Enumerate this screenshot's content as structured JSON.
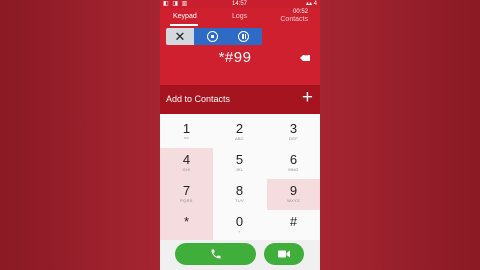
{
  "status": {
    "left": "◧ ◨ ▥",
    "time": "14:57",
    "right": "▴▴ 4"
  },
  "tabs": {
    "keypad": "Keypad",
    "logs": "Logs",
    "timer": "00:52",
    "contacts": "Contacts"
  },
  "dialed_number": "*#99",
  "add_to_contacts": "Add to Contacts",
  "add_plus": "+",
  "close_symbol": "✕",
  "keys": [
    {
      "digit": "1",
      "letters": "ᴼᴼ"
    },
    {
      "digit": "2",
      "letters": "ABC"
    },
    {
      "digit": "3",
      "letters": "DEF"
    },
    {
      "digit": "4",
      "letters": "GHI"
    },
    {
      "digit": "5",
      "letters": "JKL"
    },
    {
      "digit": "6",
      "letters": "MNO"
    },
    {
      "digit": "7",
      "letters": "PQRS"
    },
    {
      "digit": "8",
      "letters": "TUV"
    },
    {
      "digit": "9",
      "letters": "WXYZ"
    },
    {
      "digit": "*",
      "letters": ""
    },
    {
      "digit": "0",
      "letters": "+"
    },
    {
      "digit": "#",
      "letters": ""
    }
  ],
  "colors": {
    "accent": "#cf2030",
    "add_bar": "#a6141f",
    "call_green": "#3fae3a",
    "recorder_blue": "#2e6bc6"
  },
  "icons": {
    "call": "phone-icon",
    "video": "video-camera-icon",
    "backspace": "backspace-icon",
    "close": "close-icon",
    "stop": "stop-icon",
    "pause": "pause-icon"
  }
}
